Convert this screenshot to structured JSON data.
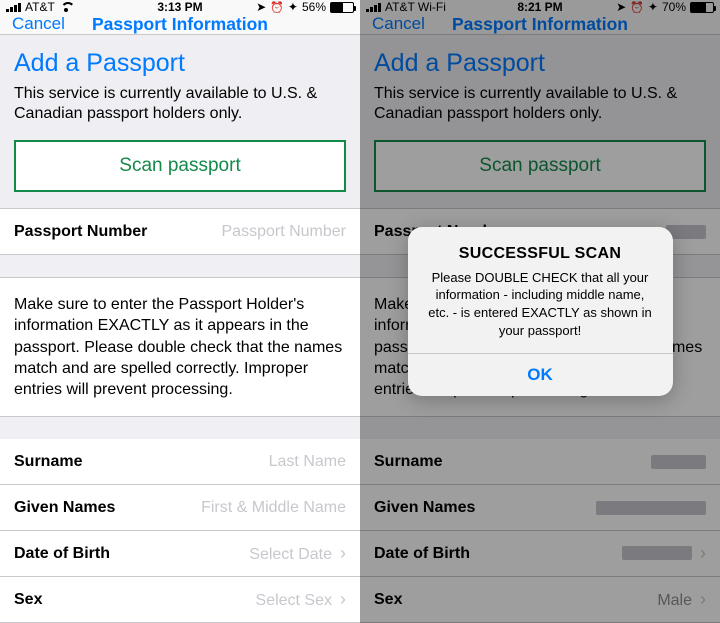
{
  "left": {
    "status": {
      "carrier": "AT&T",
      "time": "3:13 PM",
      "battery_pct": "56%",
      "wifi": true,
      "arrow": true,
      "alarm": true,
      "bt": true,
      "batt_fill": 56
    },
    "nav": {
      "cancel": "Cancel",
      "title": "Passport Information"
    },
    "hdr": {
      "title": "Add a Passport",
      "subtitle": "This service is currently available to U.S. & Canadian passport holders only.",
      "scan": "Scan passport"
    },
    "rows": {
      "passport_number": {
        "label": "Passport Number",
        "placeholder": "Passport Number"
      },
      "info": "Make sure to enter the Passport Holder's information EXACTLY as it appears in the passport.  Please double check that the names match and are spelled correctly.  Improper entries will prevent processing.",
      "surname": {
        "label": "Surname",
        "placeholder": "Last Name"
      },
      "given": {
        "label": "Given Names",
        "placeholder": "First & Middle Name"
      },
      "dob": {
        "label": "Date of Birth",
        "value": "Select Date"
      },
      "sex": {
        "label": "Sex",
        "value": "Select Sex"
      }
    }
  },
  "right": {
    "status": {
      "carrier": "AT&T Wi-Fi",
      "time": "8:21 PM",
      "battery_pct": "70%",
      "wifi": false,
      "arrow": true,
      "alarm": true,
      "bt": true,
      "batt_fill": 70
    },
    "nav": {
      "cancel": "Cancel",
      "title": "Passport Information"
    },
    "hdr": {
      "title": "Add a Passport",
      "subtitle": "This service is currently available to U.S. & Canadian passport holders only.",
      "scan": "Scan passport"
    },
    "rows": {
      "passport_number": {
        "label": "Passport Number"
      },
      "info": "Make sure to enter the Passport Holder's information EXACTLY as it appears in the passport.  Please double check that the names match and are spelled correctly.  Improper entries will prevent processing.",
      "surname": {
        "label": "Surname"
      },
      "given": {
        "label": "Given Names"
      },
      "dob": {
        "label": "Date of Birth"
      },
      "sex": {
        "label": "Sex",
        "value": "Male"
      }
    },
    "alert": {
      "title": "SUCCESSFUL SCAN",
      "msg": "Please DOUBLE CHECK that all your information - including middle name, etc. - is entered EXACTLY as shown in your passport!",
      "ok": "OK"
    }
  }
}
